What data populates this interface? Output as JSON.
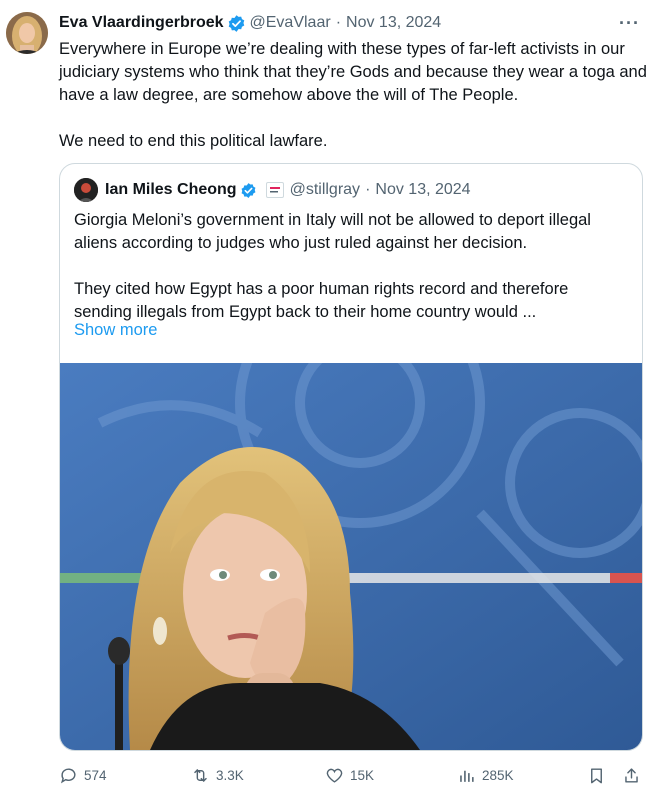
{
  "tweet": {
    "author_name": "Eva Vlaardingerbroek",
    "handle": "@EvaVlaar",
    "separator": "·",
    "date": "Nov 13, 2024",
    "more_menu": "···",
    "text_paragraphs": [
      "Everywhere in Europe we’re dealing with these types of far-left activists in our judiciary systems who think that they’re Gods and because they wear a toga and have a law degree, are somehow above the will of The People.",
      "We need to end this political lawfare."
    ]
  },
  "quoted": {
    "author_name": "Ian Miles Cheong",
    "handle": "@stillgray",
    "separator": "·",
    "date": "Nov 13, 2024",
    "text_paragraphs": [
      "Giorgia Meloni’s government in Italy will not be allowed to deport illegal aliens according to judges who just ruled against her decision.",
      "They cited how Egypt has a poor human rights record and therefore sending illegals from Egypt back to their home country would ..."
    ],
    "show_more": "Show more",
    "image_subject": "woman-resting-cheek-on-hand-photo"
  },
  "actions": {
    "replies": "574",
    "reposts": "3.3K",
    "likes": "15K",
    "views": "285K"
  },
  "colors": {
    "accent": "#1d9bf0",
    "muted": "#536471",
    "border": "#cfd9de",
    "text": "#0f1419",
    "photo_background": "#3f6fb0"
  },
  "icons": [
    "verified-badge-icon",
    "more-icon",
    "reply-icon",
    "repost-icon",
    "like-icon",
    "views-icon",
    "bookmark-icon",
    "share-icon"
  ]
}
